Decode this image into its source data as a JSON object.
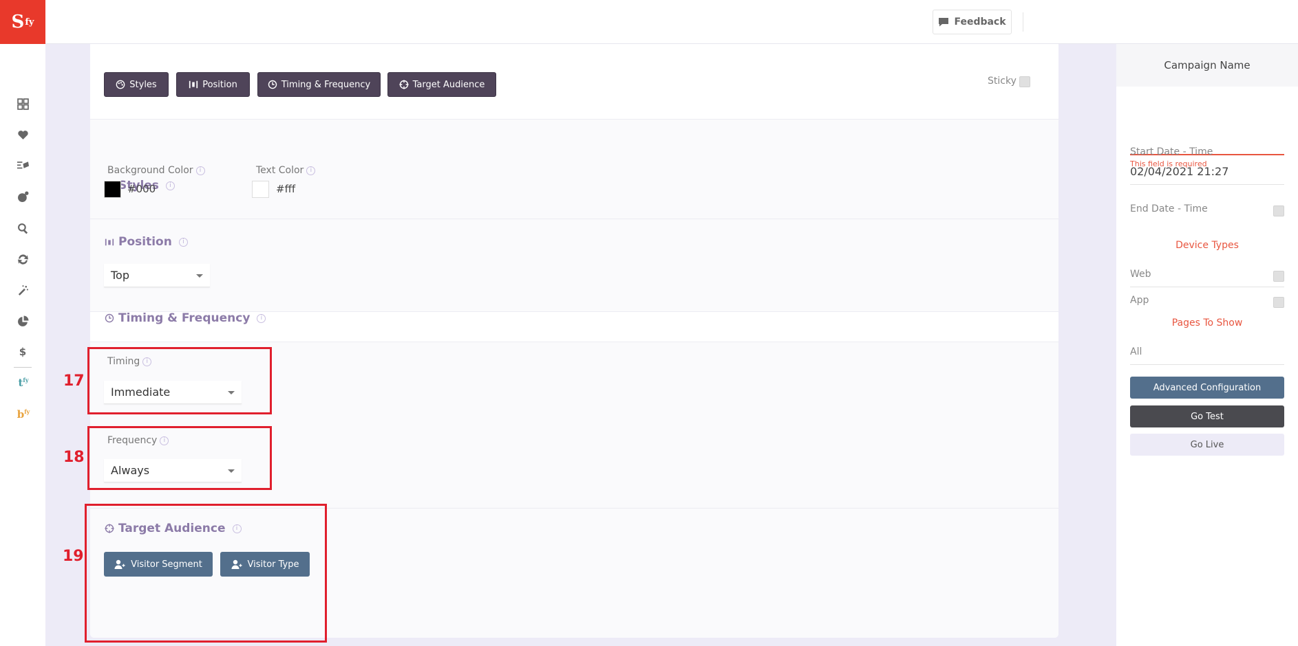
{
  "logo": {
    "main": "S",
    "sup": "fy"
  },
  "sidebar": {
    "items": [
      {
        "name": "dashboard-icon"
      },
      {
        "name": "heart-icon"
      },
      {
        "name": "campaigns-icon"
      },
      {
        "name": "analytics-icon"
      },
      {
        "name": "search-icon"
      },
      {
        "name": "sync-icon"
      },
      {
        "name": "magic-wand-icon"
      },
      {
        "name": "pie-chart-icon"
      },
      {
        "name": "dollar-icon"
      }
    ],
    "brands": [
      {
        "main": "t",
        "sup": "fy",
        "color": "#4a9ea6"
      },
      {
        "main": "b",
        "sup": "fy",
        "color": "#e8a23c"
      }
    ]
  },
  "topbar": {
    "feedback_label": "Feedback"
  },
  "toolbar": {
    "tabs": [
      {
        "label": "Styles",
        "icon": "palette-icon"
      },
      {
        "label": "Position",
        "icon": "position-icon"
      },
      {
        "label": "Timing & Frequency",
        "icon": "clock-icon"
      },
      {
        "label": "Target Audience",
        "icon": "crosshair-icon"
      }
    ],
    "sticky_label": "Sticky"
  },
  "styles": {
    "title": "Styles",
    "background_color_label": "Background Color",
    "background_color_value": "#000",
    "text_color_label": "Text Color",
    "text_color_value": "#fff"
  },
  "position": {
    "title": "Position",
    "value": "Top"
  },
  "timing_frequency": {
    "title": "Timing & Frequency",
    "timing_label": "Timing",
    "timing_value": "Immediate",
    "frequency_label": "Frequency",
    "frequency_value": "Always"
  },
  "target_audience": {
    "title": "Target Audience",
    "visitor_segment_label": "Visitor Segment",
    "visitor_type_label": "Visitor Type"
  },
  "annotations": {
    "a17": "17",
    "a18": "18",
    "a19": "19"
  },
  "right_panel": {
    "campaign_name_label": "Campaign Name",
    "campaign_name_value": "",
    "error": "This field is required",
    "start_label": "Start Date - Time",
    "start_value": "02/04/2021 21:27",
    "end_label": "End Date - Time",
    "device_types_heading": "Device Types",
    "web_label": "Web",
    "app_label": "App",
    "pages_heading": "Pages To Show",
    "pages_value": "All",
    "advanced_label": "Advanced Configuration",
    "go_test_label": "Go Test",
    "go_live_label": "Go Live"
  },
  "colors": {
    "accent": "#e8392b",
    "tab_bg": "#4f4459",
    "action_bg": "#536f8c",
    "error": "#e8553f",
    "section_title": "#8c7ba8",
    "annotation": "#e01f2d"
  }
}
